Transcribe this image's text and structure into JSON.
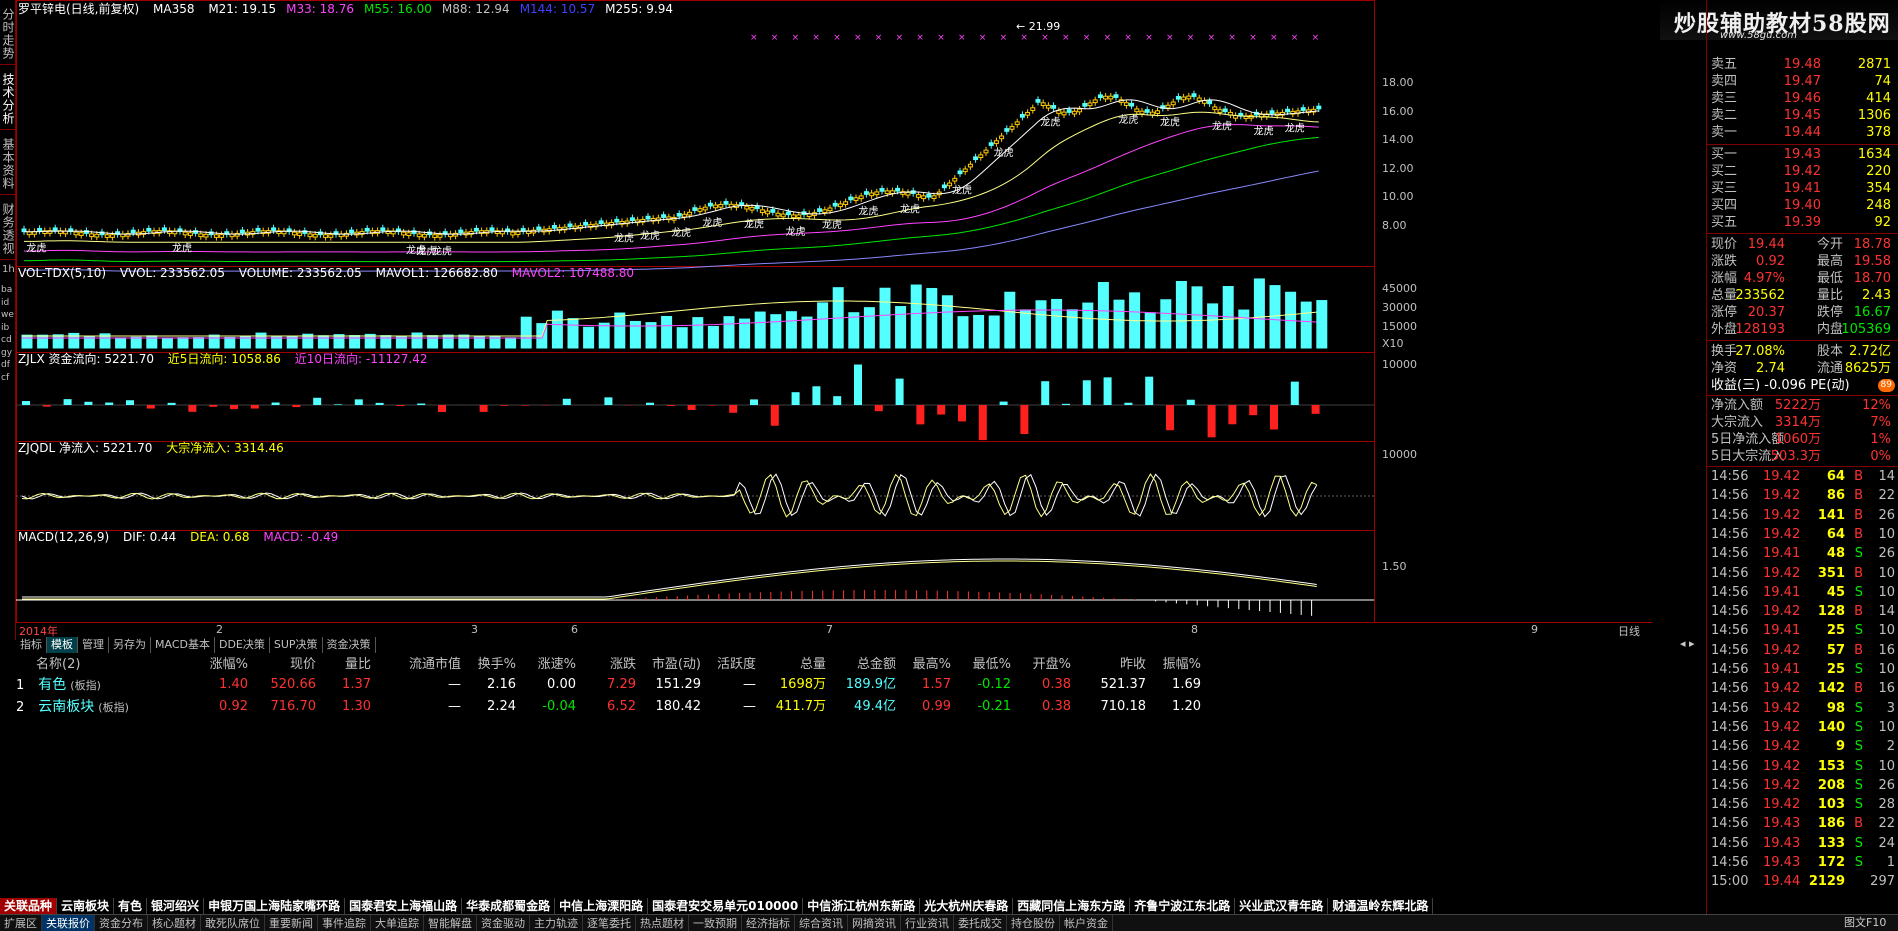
{
  "left_tabs": [
    "分时走势",
    "技术分析",
    "基本资料",
    "财务透视"
  ],
  "left_tab_small": "1h",
  "main_title": {
    "stock": "罗平锌电(日线,前复权)",
    "ma_label": "MA358",
    "ma": [
      {
        "k": "M21: 19.15",
        "c": "#ffffff"
      },
      {
        "k": "M33: 18.76",
        "c": "#ff44ff"
      },
      {
        "k": "M55: 16.00",
        "c": "#00e600"
      },
      {
        "k": "M88: 12.94",
        "c": "#c0c0c0"
      },
      {
        "k": "M144: 10.57",
        "c": "#4040ff"
      },
      {
        "k": "M255: 9.94",
        "c": "#ffffff"
      }
    ],
    "high_label": "21.99",
    "candle_label": "龙虎"
  },
  "price_axis": [
    "18.00",
    "16.00",
    "14.00",
    "12.00",
    "10.00",
    "8.00"
  ],
  "vol_title": {
    "a": "VOL-TDX(5,10)",
    "b": "VVOL: 233562.05",
    "c": "VOLUME: 233562.05",
    "d": "MAVOL1: 126682.80",
    "e": "MAVOL2: 107488.80"
  },
  "vol_axis": [
    "45000",
    "30000",
    "15000"
  ],
  "vol_unit": "X10",
  "zjlx_title": {
    "a": "ZJLX 资金流向: 5221.70",
    "b": "近5日流向: 1058.86",
    "c": "近10日流向: -11127.42"
  },
  "zjlx_axis": "10000",
  "zjqdl_title": {
    "a": "ZJQDL 净流入: 5221.70",
    "b": "大宗净流入: 3314.46"
  },
  "zjqdl_axis": "10000",
  "macd_title": {
    "a": "MACD(12,26,9)",
    "b": "DIF: 0.44",
    "c": "DEA: 0.68",
    "d": "MACD: -0.49"
  },
  "macd_axis": "1.50",
  "time_axis": [
    {
      "t": "2014年"
    },
    {
      "t": "2"
    },
    {
      "t": "3"
    },
    {
      "t": "6"
    },
    {
      "t": "7"
    },
    {
      "t": "8"
    },
    {
      "t": "9"
    }
  ],
  "period_label": "日线",
  "side_labels": [
    "ba",
    "id",
    "we",
    "ib",
    "cd",
    "gy",
    "df",
    "cf"
  ],
  "panel_tabs": [
    "指标",
    "模板",
    "管理",
    "另存为",
    "MACD基本",
    "DDE决策",
    "SUP决策",
    "资金决策"
  ],
  "table": {
    "headers": [
      "名称(2)",
      "涨幅%",
      "现价",
      "量比",
      "流通市值",
      "换手%",
      "涨速%",
      "涨跌",
      "市盈(动)",
      "活跃度",
      "总量",
      "总金额",
      "最高%",
      "最低%",
      "开盘%",
      "昨收",
      "振幅%"
    ],
    "rows": [
      {
        "idx": "1",
        "name": "有色",
        "tag": "(板指)",
        "cells": [
          "1.40",
          "520.66",
          "1.37",
          "—",
          "2.16",
          "0.00",
          "7.29",
          "151.29",
          "—",
          "1698万",
          "189.9亿",
          "1.57",
          "-0.12",
          "0.38",
          "521.37",
          "1.69"
        ]
      },
      {
        "idx": "2",
        "name": "云南板块",
        "tag": "(板指)",
        "cells": [
          "0.92",
          "716.70",
          "1.30",
          "—",
          "2.24",
          "-0.04",
          "6.52",
          "180.42",
          "—",
          "411.7万",
          "49.4亿",
          "0.99",
          "-0.21",
          "0.38",
          "710.18",
          "1.20"
        ]
      }
    ]
  },
  "logo": {
    "text": "炒股辅助教材58股网",
    "url": "www.58gu.com"
  },
  "quote": {
    "sell": [
      [
        "卖五",
        "19.48",
        "2871"
      ],
      [
        "卖四",
        "19.47",
        "74"
      ],
      [
        "卖三",
        "19.46",
        "414"
      ],
      [
        "卖二",
        "19.45",
        "1306"
      ],
      [
        "卖一",
        "19.44",
        "378"
      ]
    ],
    "buy": [
      [
        "买一",
        "19.43",
        "1634"
      ],
      [
        "买二",
        "19.42",
        "220"
      ],
      [
        "买三",
        "19.41",
        "354"
      ],
      [
        "买四",
        "19.40",
        "248"
      ],
      [
        "买五",
        "19.39",
        "92"
      ]
    ],
    "stats": [
      [
        "现价",
        "19.44",
        "今开",
        "18.78"
      ],
      [
        "涨跌",
        "0.92",
        "最高",
        "19.58"
      ],
      [
        "涨幅",
        "4.97%",
        "最低",
        "18.70"
      ],
      [
        "总量",
        "233562",
        "量比",
        "2.43"
      ],
      [
        "涨停",
        "20.37",
        "跌停",
        "16.67"
      ],
      [
        "外盘",
        "128193",
        "内盘",
        "105369"
      ]
    ],
    "stats2": [
      [
        "换手",
        "27.08%",
        "股本",
        "2.72亿"
      ],
      [
        "净资",
        "2.74",
        "流通",
        "8625万"
      ]
    ],
    "pe": "收益(三) -0.096 PE(动)",
    "flows": [
      [
        "净流入额",
        "5222万",
        "12%"
      ],
      [
        "大宗流入",
        "3314万",
        "7%"
      ],
      [
        "5日净流入额",
        "1060万",
        "1%"
      ],
      [
        "5日大宗流入",
        "503.3万",
        "0%"
      ]
    ],
    "ticks": [
      [
        "14:56",
        "19.42",
        "64",
        "B",
        "14"
      ],
      [
        "14:56",
        "19.42",
        "86",
        "B",
        "22"
      ],
      [
        "14:56",
        "19.42",
        "141",
        "B",
        "26"
      ],
      [
        "14:56",
        "19.42",
        "64",
        "B",
        "10"
      ],
      [
        "14:56",
        "19.41",
        "48",
        "S",
        "26"
      ],
      [
        "14:56",
        "19.42",
        "351",
        "B",
        "10"
      ],
      [
        "14:56",
        "19.41",
        "45",
        "S",
        "10"
      ],
      [
        "14:56",
        "19.42",
        "128",
        "B",
        "14"
      ],
      [
        "14:56",
        "19.41",
        "25",
        "S",
        "10"
      ],
      [
        "14:56",
        "19.42",
        "57",
        "B",
        "16"
      ],
      [
        "14:56",
        "19.41",
        "25",
        "S",
        "10"
      ],
      [
        "14:56",
        "19.42",
        "142",
        "B",
        "16"
      ],
      [
        "14:56",
        "19.42",
        "98",
        "S",
        "3"
      ],
      [
        "14:56",
        "19.42",
        "140",
        "S",
        "10"
      ],
      [
        "14:56",
        "19.42",
        "9",
        "S",
        "2"
      ],
      [
        "14:56",
        "19.42",
        "153",
        "S",
        "10"
      ],
      [
        "14:56",
        "19.42",
        "208",
        "S",
        "26"
      ],
      [
        "14:56",
        "19.42",
        "103",
        "S",
        "28"
      ],
      [
        "14:56",
        "19.43",
        "186",
        "B",
        "22"
      ],
      [
        "14:56",
        "19.43",
        "133",
        "S",
        "24"
      ],
      [
        "14:56",
        "19.43",
        "172",
        "S",
        "1"
      ],
      [
        "15:00",
        "19.44",
        "2129",
        "",
        "297"
      ]
    ]
  },
  "broker_bar": [
    "关联品种",
    "云南板块",
    "有色",
    "银河绍兴",
    "申银万国上海陆家嘴环路",
    "国泰君安上海福山路",
    "华泰成都蜀金路",
    "中信上海溧阳路",
    "国泰君安交易单元010000",
    "中信浙江杭州东新路",
    "光大杭州庆春路",
    "西藏同信上海东方路",
    "齐鲁宁波江东北路",
    "兴业武汉青年路",
    "财通温岭东辉北路"
  ],
  "status_bar": [
    "扩展区",
    "关联报价",
    "资金分布",
    "核心题材",
    "敢死队席位",
    "重要新闻",
    "事件追踪",
    "大单追踪",
    "智能解盘",
    "资金驱动",
    "主力轨迹",
    "逐笔委托",
    "热点题材",
    "一致预期",
    "经济指标",
    "综合资讯",
    "网摘资讯",
    "行业资讯",
    "委托成交",
    "持仓股份",
    "帐户资金"
  ],
  "status_right": "图文F10"
}
